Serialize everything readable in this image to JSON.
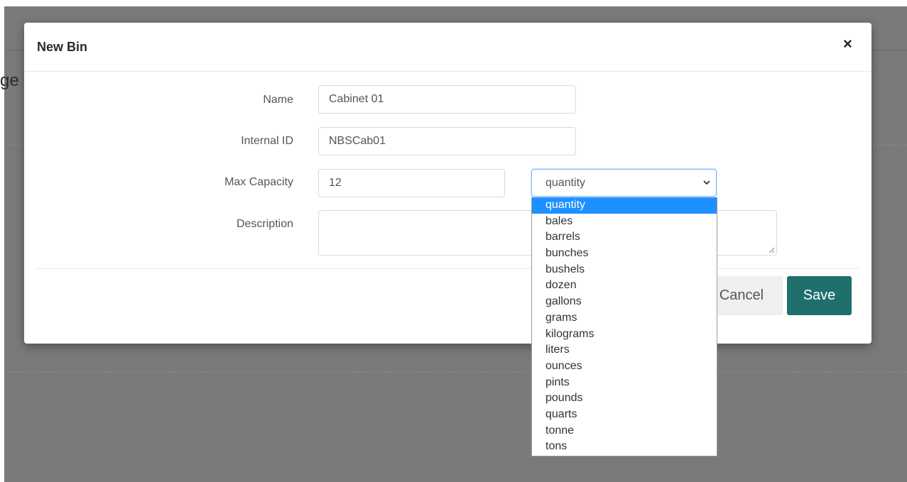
{
  "background": {
    "title_fragment": "ge"
  },
  "modal": {
    "title": "New Bin",
    "close_symbol": "×",
    "fields": {
      "name": {
        "label": "Name",
        "value": "Cabinet 01"
      },
      "internal_id": {
        "label": "Internal ID",
        "value": "NBSCab01"
      },
      "max_capacity": {
        "label": "Max Capacity",
        "value": "12",
        "unit_selected": "quantity"
      },
      "description": {
        "label": "Description",
        "value": ""
      }
    },
    "buttons": {
      "cancel": "Cancel",
      "save": "Save"
    }
  },
  "unit_dropdown": {
    "selected_index": 0,
    "options": [
      "quantity",
      "bales",
      "barrels",
      "bunches",
      "bushels",
      "dozen",
      "gallons",
      "grams",
      "kilograms",
      "liters",
      "ounces",
      "pints",
      "pounds",
      "quarts",
      "tonne",
      "tons"
    ]
  },
  "colors": {
    "primary": "#1f6f6c",
    "highlight": "#1e90ff",
    "focus_border": "#80b7ff",
    "overlay": "#7a7a7a"
  },
  "icons": {
    "close": "close-icon",
    "select_arrow": "chevron-down-icon"
  }
}
